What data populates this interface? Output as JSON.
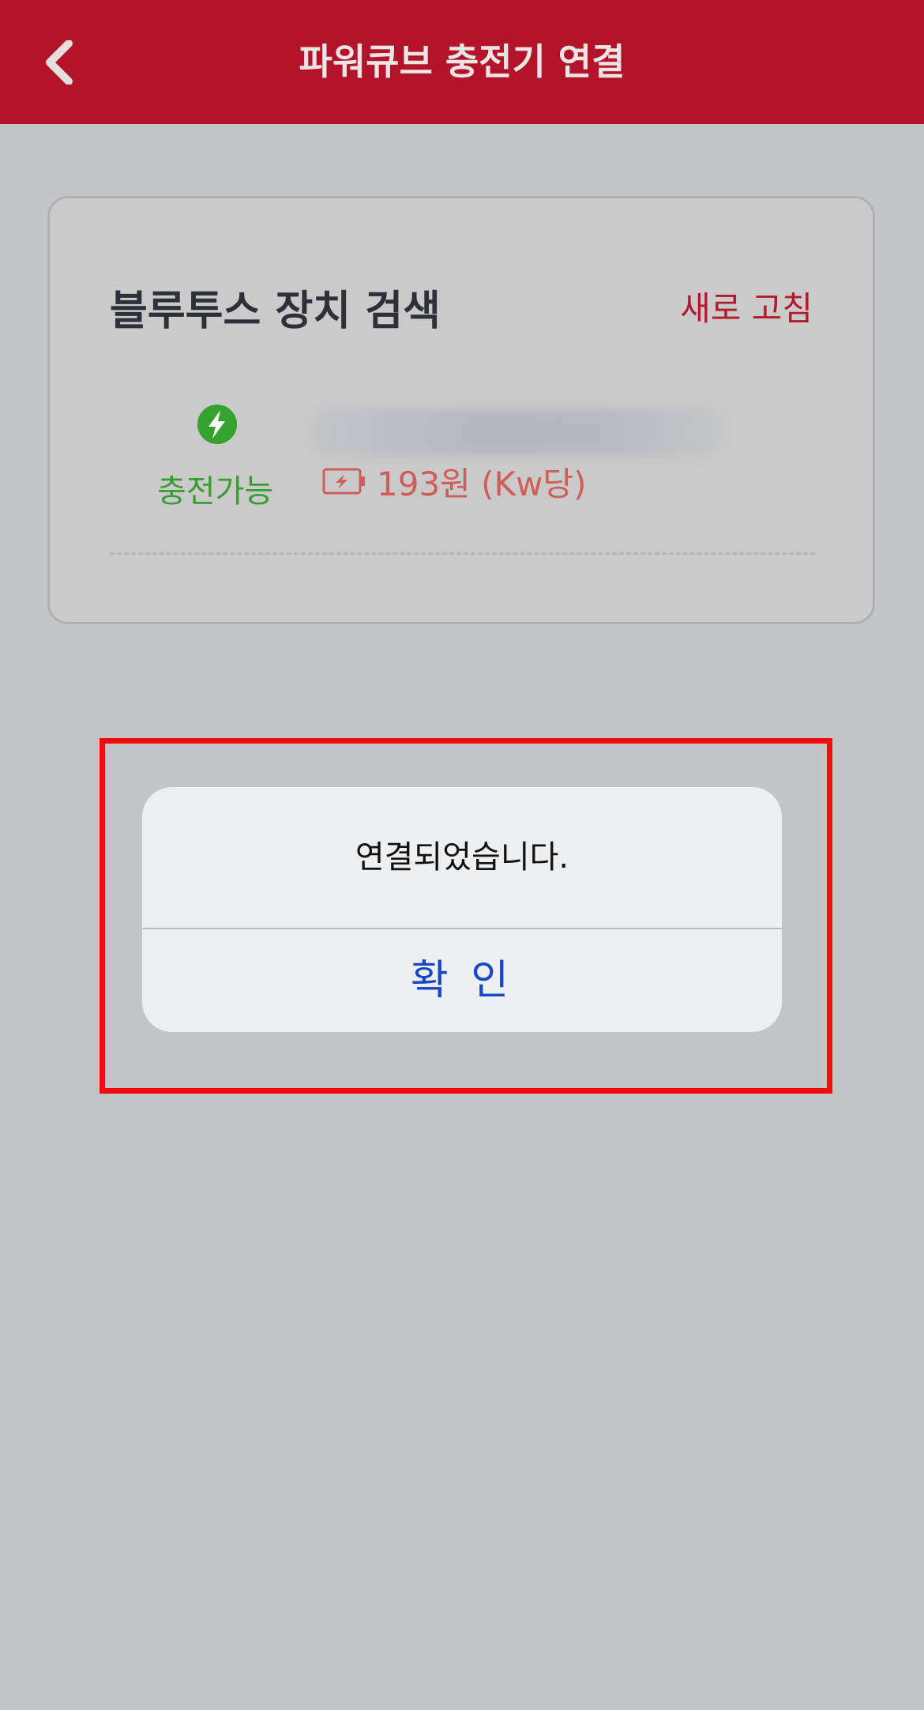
{
  "header": {
    "title": "파워큐브 충전기 연결",
    "back_icon": "chevron-left-icon"
  },
  "bluetooth_card": {
    "title": "블루투스 장치 검색",
    "refresh_label": "새로 고침",
    "device": {
      "status_icon": "lightning-circle-icon",
      "status_text": "충전가능",
      "price_icon": "battery-charging-icon",
      "price_text": "193원 (Kw당)"
    }
  },
  "alert": {
    "message": "연결되었습니다.",
    "confirm_label": "확 인"
  },
  "colors": {
    "header_bg": "#b31429",
    "accent_red": "#b01c2c",
    "available_green": "#3b9c34",
    "price_red": "#cf5d5a",
    "confirm_blue": "#1a47c4",
    "highlight_border": "#f20c0c"
  }
}
